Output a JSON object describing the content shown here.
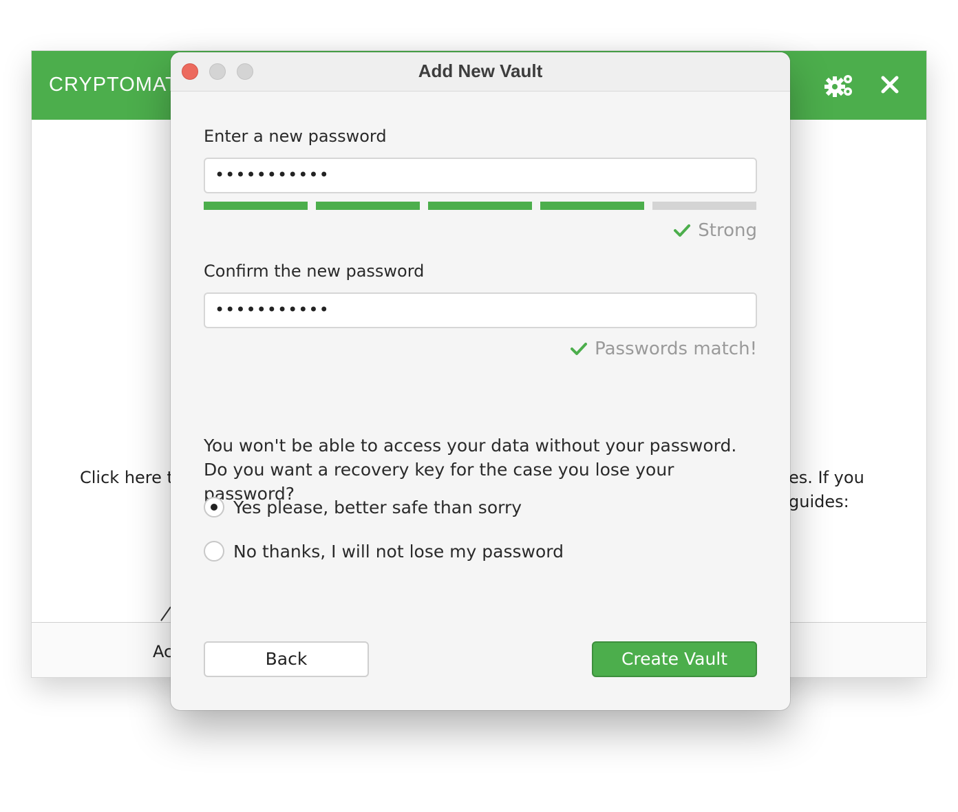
{
  "main_window": {
    "logo_text": "CRYPTOMAT",
    "settings_icon": "gears-icon",
    "close_icon": "close-x-icon",
    "background_text_left": "Click here t",
    "background_text_right_line1": "es. If you",
    "background_text_right_line2": "guides:",
    "footer_partial_text": "Ac",
    "brand_color": "#4cae4c"
  },
  "dialog": {
    "title": "Add New Vault",
    "password": {
      "label": "Enter a new password",
      "value": "•••••••••••",
      "strength_level": 4,
      "strength_max": 5,
      "strength_text": "Strong"
    },
    "confirm": {
      "label": "Confirm the new password",
      "value": "•••••••••••",
      "match_text": "Passwords match!"
    },
    "recovery": {
      "question": "You won't be able to access your data without your password. Do you want a recovery key for the case you lose your password?",
      "options": [
        {
          "label": "Yes please, better safe than sorry",
          "selected": true
        },
        {
          "label": "No thanks, I will not lose my password",
          "selected": false
        }
      ]
    },
    "buttons": {
      "back_label": "Back",
      "create_label": "Create Vault"
    }
  }
}
